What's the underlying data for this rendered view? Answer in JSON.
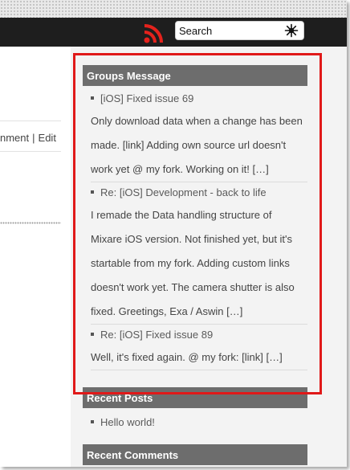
{
  "header": {
    "search": {
      "value": "Search"
    }
  },
  "left": {
    "links_partial": "nment",
    "separator": "|",
    "edit_link": "Edit"
  },
  "groups_message": {
    "title": "Groups Message",
    "items": [
      {
        "title": "[iOS] Fixed issue 69",
        "text": "Only download data when a change has been made. [link] Adding own source url doesn't work yet @ my fork. Working on it!",
        "more": "[…]"
      },
      {
        "title": "Re: [iOS] Development - back to life",
        "text": "I remade the Data handling structure of Mixare iOS version. Not finished yet, but it's startable from my fork. Adding custom links doesn't work yet. The camera shutter is also fixed. Greetings, Exa / Aswin",
        "more": "[…]"
      },
      {
        "title": "Re: [iOS] Fixed issue 89",
        "text": "Well, it's fixed again. @ my fork: [link]",
        "more": "[…]"
      }
    ]
  },
  "recent_posts": {
    "title": "Recent Posts",
    "items": [
      {
        "title": "Hello world!"
      }
    ]
  },
  "recent_comments": {
    "title": "Recent Comments"
  },
  "colors": {
    "header_bg": "#1e1e1e",
    "widget_title_bg": "#6d6d6d",
    "rss_red": "#e5221c",
    "highlight_red": "#e01919"
  },
  "icons": [
    "rss-icon",
    "search-icon"
  ]
}
